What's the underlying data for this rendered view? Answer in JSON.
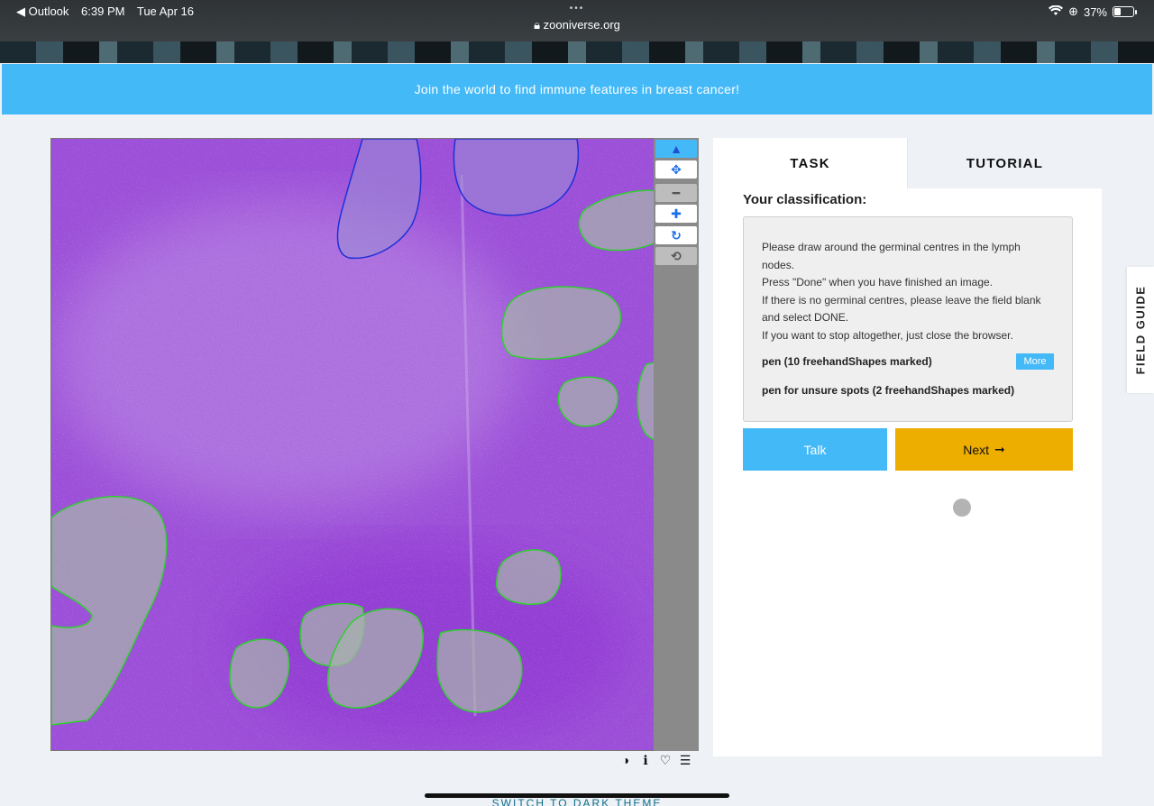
{
  "status_bar": {
    "back_app": "◀ Outlook",
    "time": "6:39 PM",
    "date": "Tue Apr 16",
    "dots": "•••",
    "url": "zooniverse.org",
    "battery": "37%",
    "battery_level": 0.37,
    "icons": [
      "back-icon",
      "lock-icon",
      "wifi-icon",
      "orientation-lock-icon",
      "battery-icon"
    ]
  },
  "banner": {
    "text": "Join the world to find immune features in breast cancer!",
    "color": "#43b9f8"
  },
  "viewer": {
    "image_description": "",
    "tools": [
      {
        "name": "select-pointer-icon",
        "glyph": "▲",
        "state": "active"
      },
      {
        "name": "move-icon",
        "glyph": "✥",
        "state": "normal"
      },
      {
        "name": "zoom-out-icon",
        "glyph": "━",
        "state": "disabled"
      },
      {
        "name": "zoom-in-icon",
        "glyph": "✚",
        "state": "normal"
      },
      {
        "name": "rotate-icon",
        "glyph": "↻",
        "state": "normal"
      },
      {
        "name": "reset-icon",
        "glyph": "⟲",
        "state": "disabled"
      }
    ],
    "footer_icons": [
      "invert-icon",
      "info-icon",
      "heart-icon",
      "collections-list-icon"
    ],
    "footer_glyphs": [
      "◑",
      "ℹ",
      "♡",
      "☰"
    ],
    "colors": {
      "tissue": "#9c4fd8",
      "germinal_mark": "#2fd02f",
      "unsure_mark": "#1f2fd8"
    }
  },
  "panel": {
    "tabs": [
      {
        "label": "TASK",
        "active": true
      },
      {
        "label": "TUTORIAL",
        "active": false
      }
    ],
    "heading": "Your classification:",
    "instructions": [
      "Please draw around the germinal centres in the lymph nodes.",
      "Press \"Done\" when you have finished an image.",
      "If there is no germinal centres, please leave the field blank and select DONE.",
      "If you want to stop altogether, just close the browser."
    ],
    "tools": [
      {
        "label": "pen (10 freehandShapes marked)",
        "more_label": "More"
      },
      {
        "label": "pen for unsure spots (2 freehandShapes marked)"
      }
    ],
    "talk_label": "Talk",
    "next_label": "Next",
    "next_arrow": "➞"
  },
  "field_guide": {
    "label": "FIELD GUIDE"
  },
  "footer": {
    "dark_theme_label": "SWITCH TO DARK THEME"
  }
}
